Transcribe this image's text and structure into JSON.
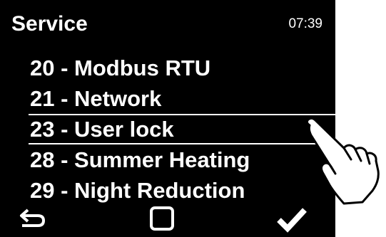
{
  "header": {
    "title": "Service",
    "time": "07:39"
  },
  "menu": {
    "items": [
      {
        "label": "20 - Modbus RTU",
        "selected": false
      },
      {
        "label": "21 - Network",
        "selected": false
      },
      {
        "label": "23 - User lock",
        "selected": true
      },
      {
        "label": "28 - Summer Heating",
        "selected": false
      },
      {
        "label": "29 - Night Reduction",
        "selected": false
      }
    ]
  },
  "footer": {
    "back_icon": "back-arrow-icon",
    "home_icon": "square-icon",
    "confirm_icon": "checkmark-icon"
  },
  "overlay": {
    "pointer_icon": "pointing-hand-icon"
  },
  "colors": {
    "screen_background": "#000000",
    "text": "#ffffff",
    "page_background": "#ffffff"
  }
}
